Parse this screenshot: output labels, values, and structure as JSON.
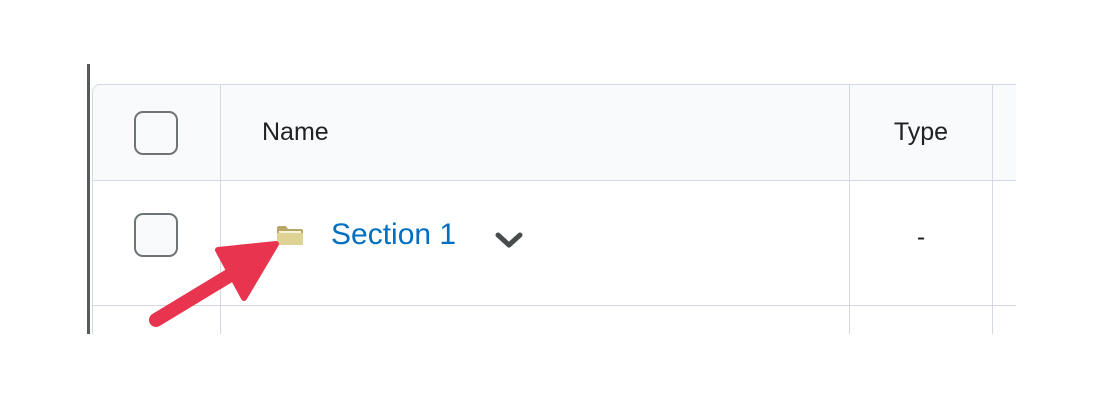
{
  "table": {
    "columns": [
      {
        "key": "select",
        "label": ""
      },
      {
        "key": "name",
        "label": "Name"
      },
      {
        "key": "type",
        "label": "Type"
      }
    ],
    "rows": [
      {
        "name": "Section 1",
        "type": "-",
        "icon": "folder-icon",
        "menu_icon": "chevron-down-icon"
      }
    ]
  },
  "annotation": {
    "icon": "arrow-icon",
    "color": "#e8344e"
  },
  "colors": {
    "link": "#006fbf",
    "border": "#d3d9e3",
    "header_bg": "#f9fafc",
    "folder": "#d9cc8c"
  }
}
